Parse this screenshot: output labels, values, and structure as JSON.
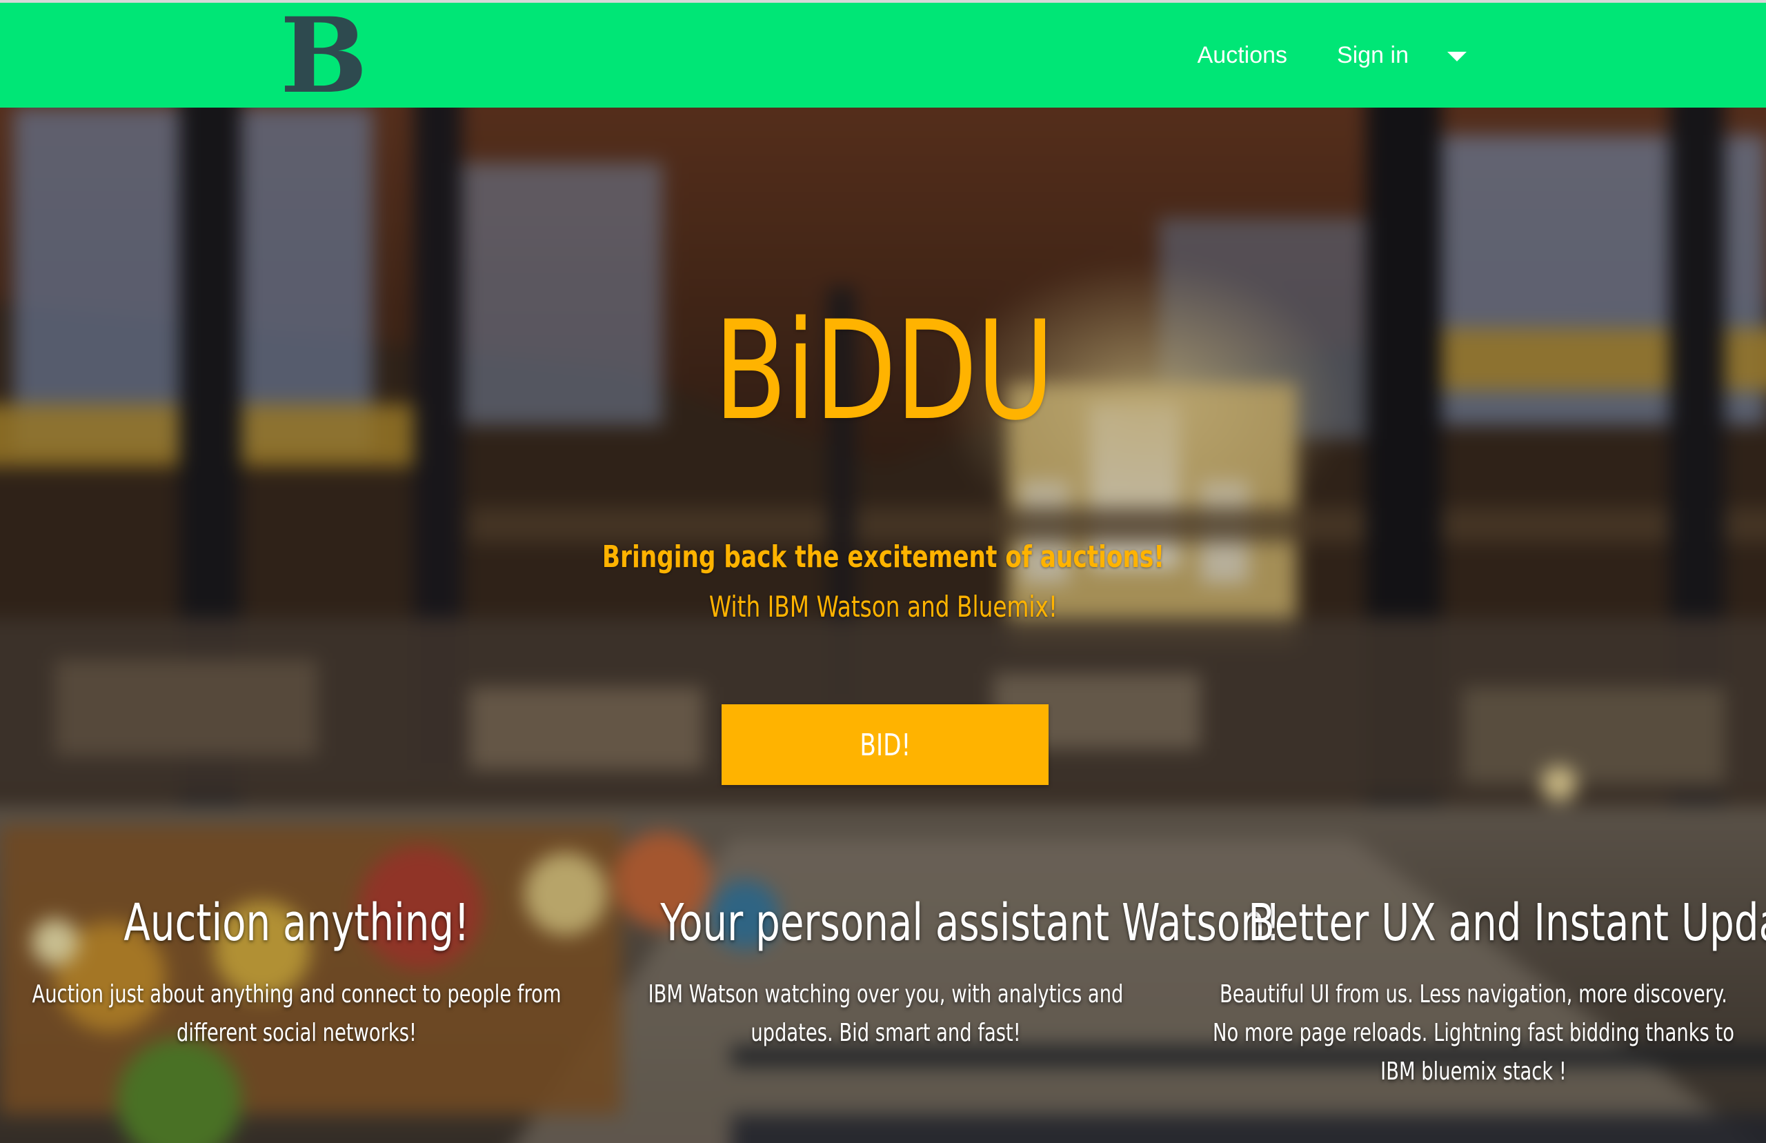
{
  "navbar": {
    "logo_text": "B",
    "links": [
      {
        "label": "Auctions"
      },
      {
        "label": "Sign in"
      }
    ],
    "dropdown_icon": "caret-down-icon",
    "background_color": "#00e676",
    "logo_color": "#2e4a4f"
  },
  "hero": {
    "title": "BiDDU",
    "tagline_line1": "Bringing back the excitement of auctions!",
    "tagline_line2": "With IBM Watson and Bluemix!",
    "cta_label": "BID!",
    "accent_color": "#ffb300",
    "background_image": "market-hall-photo"
  },
  "features": [
    {
      "title": "Auction anything!",
      "text": "Auction just about anything and connect to people from different social networks!"
    },
    {
      "title": "Your personal assistant Watson!",
      "text": "IBM Watson watching over you, with analytics and updates. Bid smart and fast!"
    },
    {
      "title": "Better UX and Instant Updates.",
      "text": "Beautiful UI from us. Less navigation, more discovery. No more page reloads. Lightning fast bidding thanks to IBM bluemix stack !"
    }
  ]
}
